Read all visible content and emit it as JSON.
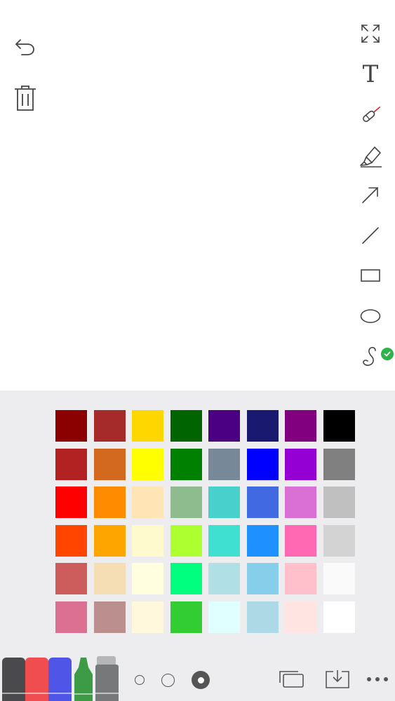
{
  "toolbar_left": {
    "undo_icon": "undo-arrow-icon",
    "delete_icon": "trash-icon"
  },
  "toolbar_right": {
    "items": [
      {
        "name": "fullscreen",
        "icon": "expand-arrows-icon"
      },
      {
        "name": "text",
        "icon": "text-T-icon",
        "label": "T"
      },
      {
        "name": "laser-pointer",
        "icon": "laser-pointer-icon"
      },
      {
        "name": "highlighter",
        "icon": "highlighter-icon"
      },
      {
        "name": "arrow",
        "icon": "arrow-icon"
      },
      {
        "name": "line",
        "icon": "line-icon"
      },
      {
        "name": "rectangle",
        "icon": "rectangle-icon"
      },
      {
        "name": "ellipse",
        "icon": "ellipse-icon"
      },
      {
        "name": "freehand",
        "icon": "freehand-curve-icon",
        "selected": true
      }
    ]
  },
  "palette": {
    "rows": [
      [
        "#8b0000",
        "#a52a2a",
        "#ffd700",
        "#006400",
        "#4b0082",
        "#191970",
        "#800080",
        "#000000"
      ],
      [
        "#b22222",
        "#d2691e",
        "#ffff00",
        "#008000",
        "#778899",
        "#0000ff",
        "#9400d3",
        "#808080"
      ],
      [
        "#ff0000",
        "#ff8c00",
        "#ffe4b5",
        "#8fbc8f",
        "#48d1cc",
        "#4169e1",
        "#da70d6",
        "#c0c0c0"
      ],
      [
        "#ff4500",
        "#ffa500",
        "#fffacd",
        "#adff2f",
        "#40e0d0",
        "#1e90ff",
        "#ff69b4",
        "#d3d3d3"
      ],
      [
        "#cd5c5c",
        "#f5deb3",
        "#ffffe0",
        "#00ff7f",
        "#b0e0e6",
        "#87ceeb",
        "#ffc0cb",
        "#fafafa"
      ],
      [
        "#db7093",
        "#bc8f8f",
        "#fff8dc",
        "#32cd32",
        "#e0ffff",
        "#add8e6",
        "#ffe4e1",
        "#ffffff"
      ]
    ]
  },
  "pens": [
    {
      "name": "dark-gray-marker",
      "color": "#4a4a4d"
    },
    {
      "name": "red-marker",
      "color": "#ef4d4f"
    },
    {
      "name": "blue-marker",
      "color": "#4f55e6"
    },
    {
      "name": "green-pen",
      "color": "#3d9a47"
    },
    {
      "name": "eraser",
      "color": "#77787a"
    }
  ],
  "brush_sizes": [
    "small",
    "medium",
    "large"
  ],
  "selected_brush_size": "large",
  "bottom_actions": {
    "copy_icon": "duplicate-pages-icon",
    "save_icon": "download-tray-icon",
    "more_icon": "more-dots-icon"
  },
  "accent_color": "#2cb34a"
}
